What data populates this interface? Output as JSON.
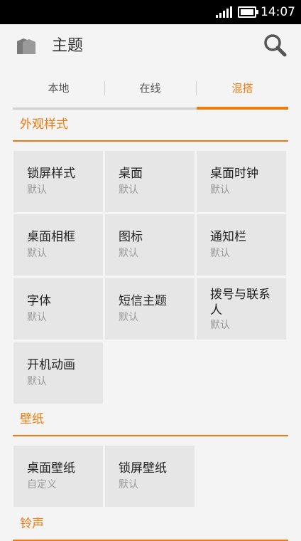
{
  "status_bar": {
    "time": "14:07"
  },
  "app_bar": {
    "title": "主题"
  },
  "tabs": [
    {
      "label": "本地",
      "active": false
    },
    {
      "label": "在线",
      "active": false
    },
    {
      "label": "混搭",
      "active": true
    }
  ],
  "sections": {
    "appearance": {
      "title": "外观样式",
      "items": [
        {
          "label": "锁屏样式",
          "value": "默认"
        },
        {
          "label": "桌面",
          "value": "默认"
        },
        {
          "label": "桌面时钟",
          "value": "默认"
        },
        {
          "label": "桌面相框",
          "value": "默认"
        },
        {
          "label": "图标",
          "value": "默认"
        },
        {
          "label": "通知栏",
          "value": "默认"
        },
        {
          "label": "字体",
          "value": "默认"
        },
        {
          "label": "短信主题",
          "value": "默认"
        },
        {
          "label": "拨号与联系人",
          "value": "默认"
        },
        {
          "label": "开机动画",
          "value": "默认"
        }
      ]
    },
    "wallpaper": {
      "title": "壁纸",
      "items": [
        {
          "label": "桌面壁纸",
          "value": "自定义"
        },
        {
          "label": "锁屏壁纸",
          "value": "默认"
        }
      ]
    },
    "ringtone": {
      "title": "铃声"
    }
  },
  "colors": {
    "accent": "#f07c10",
    "tile": "#e6e6e6",
    "background": "#f4f4f4"
  },
  "icons": {
    "app": "theme-folder-icon",
    "search": "search-icon",
    "signal": "signal-icon",
    "battery": "battery-icon"
  }
}
